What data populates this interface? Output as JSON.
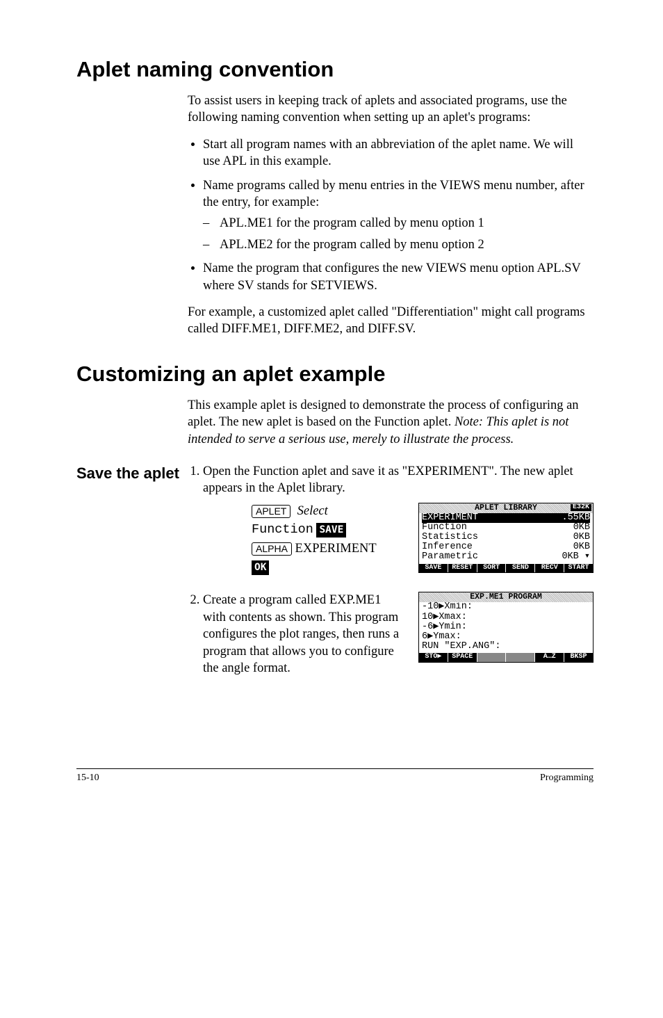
{
  "h1a": "Aplet naming convention",
  "p1": "To assist users in keeping track of aplets and associated programs, use the following naming convention when setting up an aplet's programs:",
  "b1": "Start all program names with an abbreviation of the aplet name. We will use APL in this example.",
  "b2": "Name programs called by menu entries in the VIEWS menu number, after the entry, for example:",
  "b2a": "APL.ME1 for the program called by menu option 1",
  "b2b": "APL.ME2 for the program called by menu option 2",
  "b3": "Name the program that configures the new VIEWS menu option APL.SV where SV stands for SETVIEWS.",
  "p2": "For example, a customized aplet called \"Differentiation\" might call programs called DIFF.ME1, DIFF.ME2, and DIFF.SV.",
  "h1b": "Customizing an aplet example",
  "p3a": "This example aplet is designed to demonstrate the process of configuring an aplet. The new aplet is based on the Function aplet. ",
  "p3b": "Note: This aplet is not intended to serve a serious use, merely to illustrate the process.",
  "side1": "Save the aplet",
  "step1": "Open the Function aplet and save it as \"EXPERIMENT\". The new aplet appears in the Aplet library.",
  "k_aplet": "APLET",
  "k_select": "Select",
  "k_func": "Function",
  "k_save": "SAVE",
  "k_alpha": "ALPHA",
  "k_exp": "EXPERIMENT",
  "k_ok": "OK",
  "scr1": {
    "title": "APLET LIBRARY",
    "tr": "E32K",
    "rows": [
      {
        "l": "EXPERIMENT",
        "r": ".55KB",
        "sel": true
      },
      {
        "l": "Function",
        "r": "0KB"
      },
      {
        "l": "Statistics",
        "r": "0KB"
      },
      {
        "l": "Inference",
        "r": "0KB"
      },
      {
        "l": "Parametric",
        "r": "0KB ▾"
      }
    ],
    "menu": [
      "SAVE",
      "RESET",
      "SORT",
      "SEND",
      "RECV",
      "START"
    ]
  },
  "step2": "Create a program called EXP.ME1 with contents as shown. This program configures the plot ranges, then runs a program that allows you to configure the angle format.",
  "scr2": {
    "title": "EXP.ME1 PROGRAM",
    "lines": [
      "-10▶Xmin:",
      "10▶Xmax:",
      "-6▶Ymin:",
      "6▶Ymax:",
      "RUN \"EXP.ANG\":"
    ],
    "menu": [
      "STO▶",
      "SPACE",
      "",
      "",
      "A…Z",
      "BKSP"
    ]
  },
  "foot_l": "15-10",
  "foot_r": "Programming"
}
